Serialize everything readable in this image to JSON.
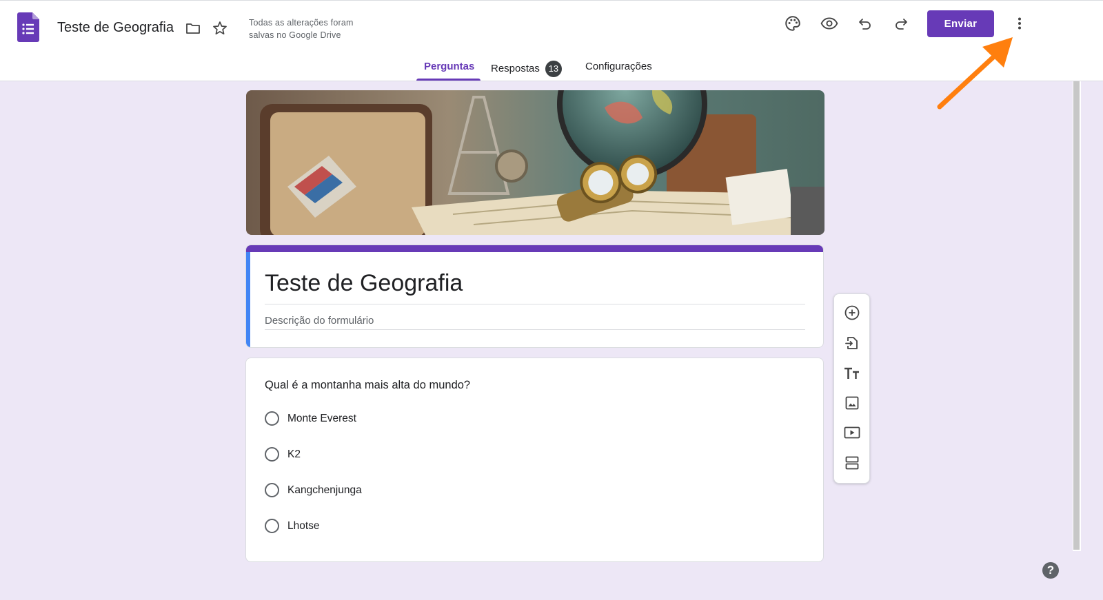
{
  "header": {
    "app_icon": "google-forms-icon",
    "doc_title": "Teste de Geografia",
    "save_status": "Todas as alterações foram salvas no Google Drive",
    "send_label": "Enviar",
    "icons": [
      "folder-icon",
      "star-icon",
      "palette-icon",
      "eye-icon",
      "undo-icon",
      "redo-icon",
      "more-vert-icon"
    ]
  },
  "tabs": [
    {
      "label": "Perguntas",
      "active": true
    },
    {
      "label": "Respostas",
      "badge": "13"
    },
    {
      "label": "Configurações"
    }
  ],
  "form": {
    "title": "Teste de Geografia",
    "description_placeholder": "Descrição do formulário"
  },
  "question": {
    "text": "Qual é a montanha mais alta do mundo?",
    "options": [
      "Monte Everest",
      "K2",
      "Kangchenjunga",
      "Lhotse"
    ]
  },
  "toolbar": {
    "icons": [
      "add-question-icon",
      "import-questions-icon",
      "add-title-icon",
      "add-image-icon",
      "add-video-icon",
      "add-section-icon"
    ]
  },
  "help_glyph": "?",
  "colors": {
    "accent": "#673ab7",
    "background": "#ede7f6",
    "left_strip": "#4285f4",
    "annotation_arrow": "#ff7f0e"
  }
}
